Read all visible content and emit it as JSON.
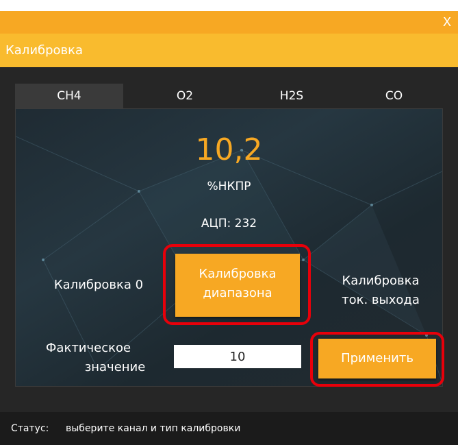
{
  "window": {
    "close_label": "X"
  },
  "header": {
    "title": "Калибровка"
  },
  "tabs": [
    {
      "label": "CH4",
      "active": true
    },
    {
      "label": "O2",
      "active": false
    },
    {
      "label": "H2S",
      "active": false
    },
    {
      "label": "CO",
      "active": false
    }
  ],
  "reading": {
    "value": "10,2",
    "unit": "%НКПР",
    "adc": "АЦП: 232"
  },
  "calibration": {
    "zero_label": "Калибровка 0",
    "range_button": {
      "line1": "Калибровка",
      "line2": "диапазона"
    },
    "current_label": {
      "line1": "Калибровка",
      "line2": "ток. выхода"
    }
  },
  "actual": {
    "label_line1": "Фактическое",
    "label_line2": "значение",
    "value": "10",
    "apply_label": "Применить"
  },
  "status": {
    "key": "Статус:",
    "text": "выберите канал и  тип калибровки"
  },
  "colors": {
    "accent": "#f7a823",
    "header": "#f9bb2e",
    "highlight": "#e8000a",
    "background": "#262626"
  }
}
